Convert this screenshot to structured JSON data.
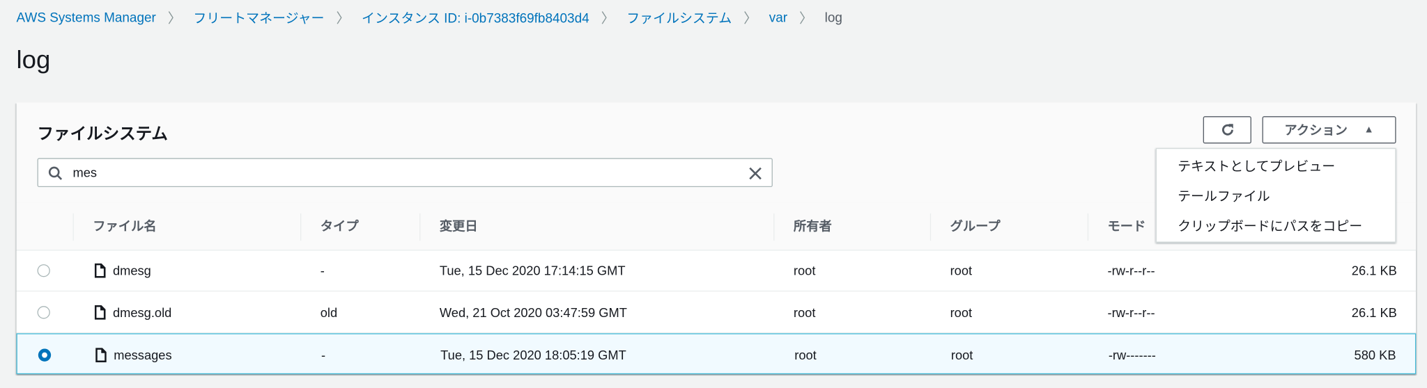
{
  "breadcrumb": [
    {
      "label": "AWS Systems Manager",
      "link": true
    },
    {
      "label": "フリートマネージャー",
      "link": true
    },
    {
      "label": "インスタンス ID: i-0b7383f69fb8403d4",
      "link": true
    },
    {
      "label": "ファイルシステム",
      "link": true
    },
    {
      "label": "var",
      "link": true
    },
    {
      "label": "log",
      "link": false
    }
  ],
  "page_title": "log",
  "panel": {
    "title": "ファイルシステム",
    "actions_label": "アクション",
    "search_value": "mes",
    "menu": [
      "テキストとしてプレビュー",
      "テールファイル",
      "クリップボードにパスをコピー"
    ]
  },
  "table": {
    "headers": [
      "ファイル名",
      "タイプ",
      "変更日",
      "所有者",
      "グループ",
      "モード"
    ],
    "rows": [
      {
        "name": "dmesg",
        "type": "-",
        "modified": "Tue, 15 Dec 2020 17:14:15 GMT",
        "owner": "root",
        "group": "root",
        "mode": "-rw-r--r--",
        "size": "26.1 KB",
        "selected": false
      },
      {
        "name": "dmesg.old",
        "type": "old",
        "modified": "Wed, 21 Oct 2020 03:47:59 GMT",
        "owner": "root",
        "group": "root",
        "mode": "-rw-r--r--",
        "size": "26.1 KB",
        "selected": false
      },
      {
        "name": "messages",
        "type": "-",
        "modified": "Tue, 15 Dec 2020 18:05:19 GMT",
        "owner": "root",
        "group": "root",
        "mode": "-rw-------",
        "size": "580 KB",
        "selected": true
      }
    ]
  },
  "colors": {
    "link": "#0073bb",
    "selected_border": "#44b9d6",
    "selected_bg": "#f1faff"
  }
}
